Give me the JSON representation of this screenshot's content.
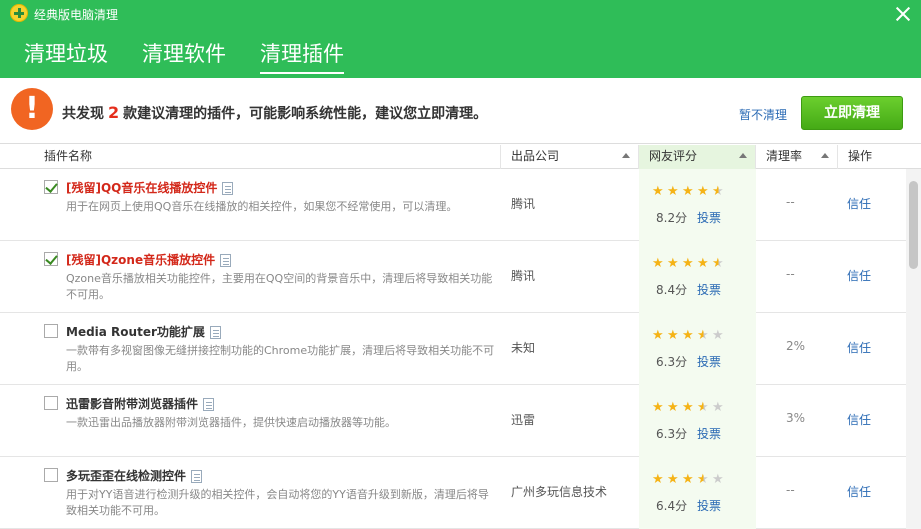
{
  "app": {
    "title": "经典版电脑清理"
  },
  "tabs": [
    {
      "label": "清理垃圾"
    },
    {
      "label": "清理软件"
    },
    {
      "label": "清理插件"
    }
  ],
  "notice": {
    "prefix": "共发现",
    "count": "2",
    "suffix": "款建议清理的插件，可能影响系统性能，建议您立即清理。",
    "skip_label": "暂不清理",
    "clean_label": "立即清理"
  },
  "columns": {
    "name": "插件名称",
    "company": "出品公司",
    "rating": "网友评分",
    "rate": "清理率",
    "action": "操作"
  },
  "rows": [
    {
      "checked": true,
      "name": "[残留]QQ音乐在线播放控件",
      "desc": "用于在网页上使用QQ音乐在线播放的相关控件，如果您不经常使用，可以清理。",
      "company": "腾讯",
      "stars": 4.5,
      "score": "8.2分",
      "vote": "投票",
      "rate": "--",
      "action": "信任"
    },
    {
      "checked": true,
      "name": "[残留]Qzone音乐播放控件",
      "desc": "Qzone音乐播放相关功能控件，主要用在QQ空间的背景音乐中，清理后将导致相关功能不可用。",
      "company": "腾讯",
      "stars": 4.5,
      "score": "8.4分",
      "vote": "投票",
      "rate": "--",
      "action": "信任"
    },
    {
      "checked": false,
      "name": "Media Router功能扩展",
      "desc": "一款带有多视窗图像无缝拼接控制功能的Chrome功能扩展，清理后将导致相关功能不可用。",
      "company": "未知",
      "stars": 3.5,
      "score": "6.3分",
      "vote": "投票",
      "rate": "2%",
      "action": "信任"
    },
    {
      "checked": false,
      "name": "迅雷影音附带浏览器插件",
      "desc": "一款迅雷出品播放器附带浏览器插件，提供快速启动播放器等功能。",
      "company": "迅雷",
      "stars": 3.5,
      "score": "6.3分",
      "vote": "投票",
      "rate": "3%",
      "action": "信任"
    },
    {
      "checked": false,
      "name": "多玩歪歪在线检测控件",
      "desc": "用于对YY语音进行检测升级的相关控件，会自动将您的YY语音升级到新版，清理后将导致相关功能不可用。",
      "company": "广州多玩信息技术",
      "stars": 3.5,
      "score": "6.4分",
      "vote": "投票",
      "rate": "--",
      "action": "信任"
    }
  ]
}
